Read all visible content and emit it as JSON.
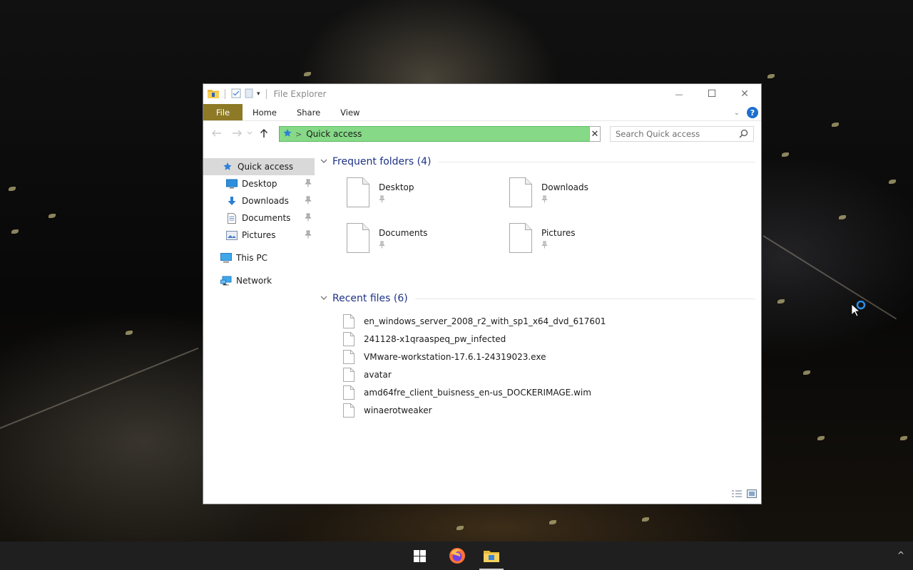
{
  "window": {
    "title": "File Explorer",
    "controls": {
      "minimize": "—",
      "maximize": "☐",
      "close": "✕"
    }
  },
  "ribbon": {
    "tabs": [
      "File",
      "Home",
      "Share",
      "View"
    ],
    "help": "?"
  },
  "address": {
    "location": "Quick access",
    "clear": "✕"
  },
  "search": {
    "placeholder": "Search Quick access"
  },
  "sidebar": {
    "quick_access": "Quick access",
    "pinned": [
      "Desktop",
      "Downloads",
      "Documents",
      "Pictures"
    ],
    "this_pc": "This PC",
    "network": "Network"
  },
  "frequent": {
    "title": "Frequent folders (4)",
    "folders": [
      "Desktop",
      "Downloads",
      "Documents",
      "Pictures"
    ]
  },
  "recent": {
    "title": "Recent files (6)",
    "files": [
      "en_windows_server_2008_r2_with_sp1_x64_dvd_617601",
      "241128-x1qraaspeq_pw_infected",
      "VMware-workstation-17.6.1-24319023.exe",
      "avatar",
      "amd64fre_client_buisness_en-us_DOCKERIMAGE.wim",
      "winaerotweaker"
    ]
  },
  "colors": {
    "file_tab": "#8e7a26",
    "address_highlight": "#86d987",
    "group_title": "#1e3287",
    "help": "#1c6fd1",
    "taskbar": "#1f1f1f"
  },
  "taskbar": {
    "icons": [
      "windows-start-icon",
      "firefox-icon",
      "file-explorer-icon"
    ],
    "tray": "^"
  }
}
